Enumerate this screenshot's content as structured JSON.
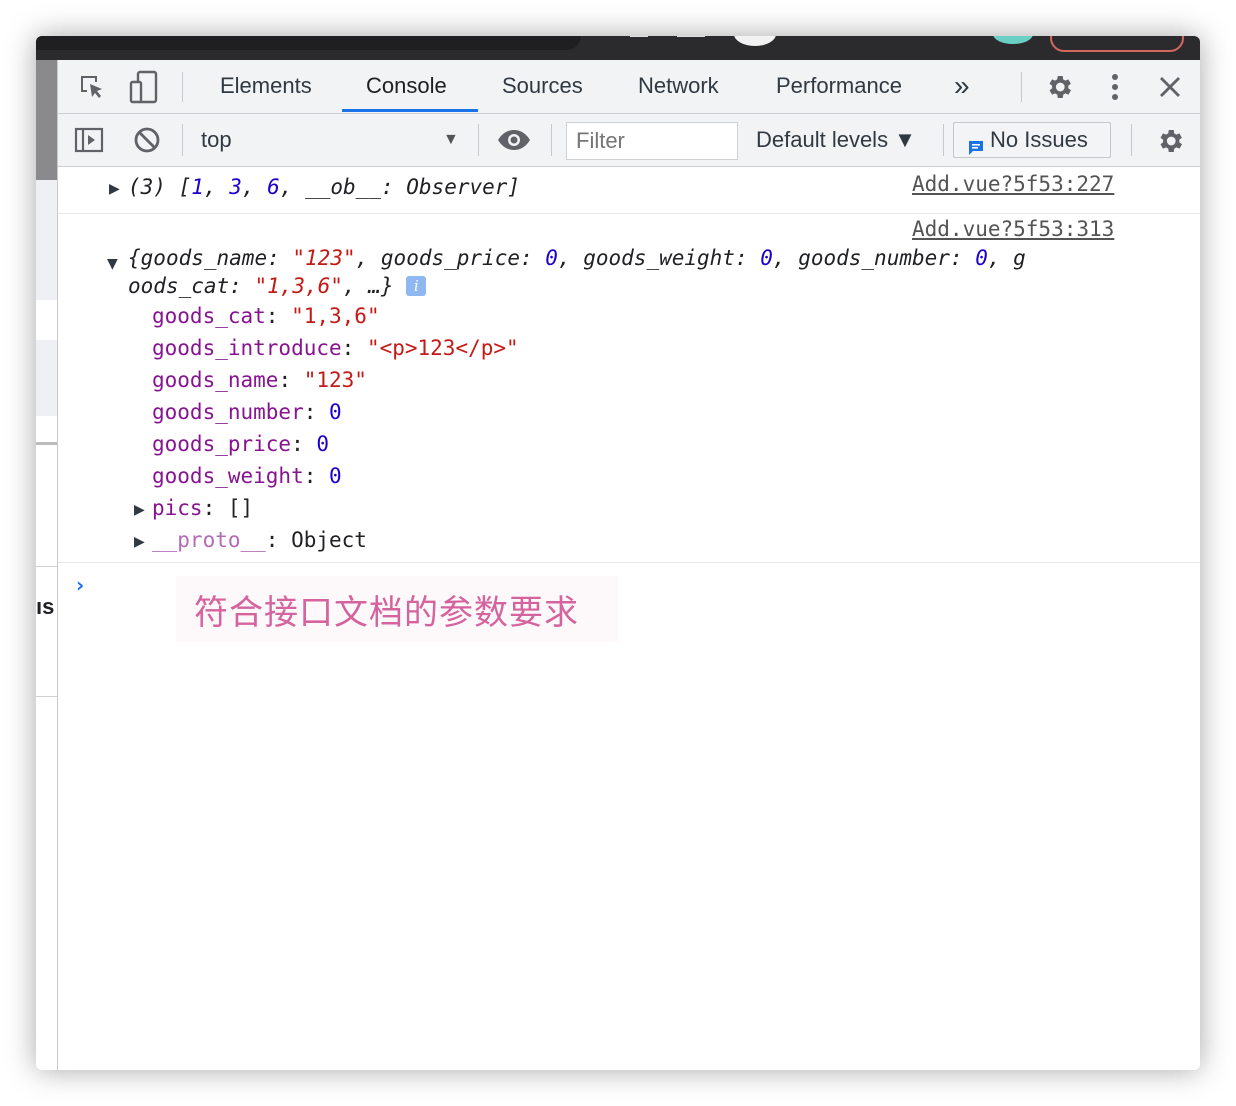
{
  "tabs": [
    {
      "label": "Elements",
      "active": false
    },
    {
      "label": "Console",
      "active": true
    },
    {
      "label": "Sources",
      "active": false
    },
    {
      "label": "Network",
      "active": false
    },
    {
      "label": "Performance",
      "active": false
    }
  ],
  "more_tabs": "»",
  "toolbar": {
    "context": "top",
    "filter_placeholder": "Filter",
    "default_levels": "Default levels ▼",
    "issues": "No Issues"
  },
  "left_panel_stub": "ıs",
  "console": {
    "entry1": {
      "source": "Add.vue?5f53:227",
      "count": "(3)",
      "values": [
        "1",
        "3",
        "6"
      ],
      "ob_key": "__ob__",
      "ob_value": "Observer"
    },
    "entry2": {
      "source": "Add.vue?5f53:313",
      "summary": {
        "k1": "goods_name",
        "v1": "\"123\"",
        "k2": "goods_price",
        "v2": "0",
        "k3": "goods_weight",
        "v3": "0",
        "k4": "goods_number",
        "v4": "0",
        "k5a": "g",
        "k5b": "oods_cat",
        "v5": "\"1,3,6\"",
        "ellipsis": "…}"
      },
      "props": [
        {
          "key": "goods_cat",
          "value": "\"1,3,6\"",
          "type": "string"
        },
        {
          "key": "goods_introduce",
          "value": "\"<p>123</p>\"",
          "type": "string"
        },
        {
          "key": "goods_name",
          "value": "\"123\"",
          "type": "string"
        },
        {
          "key": "goods_number",
          "value": "0",
          "type": "number"
        },
        {
          "key": "goods_price",
          "value": "0",
          "type": "number"
        },
        {
          "key": "goods_weight",
          "value": "0",
          "type": "number"
        }
      ],
      "pics_key": "pics",
      "pics_value": "[]",
      "proto_key": "__proto__",
      "proto_value": "Object"
    }
  },
  "annotation": "符合接口文档的参数要求",
  "colors": {
    "accent": "#1a73e8",
    "key": "#881391",
    "string": "#c41a16",
    "number": "#1c00cf",
    "annotation": "#d4639e"
  }
}
